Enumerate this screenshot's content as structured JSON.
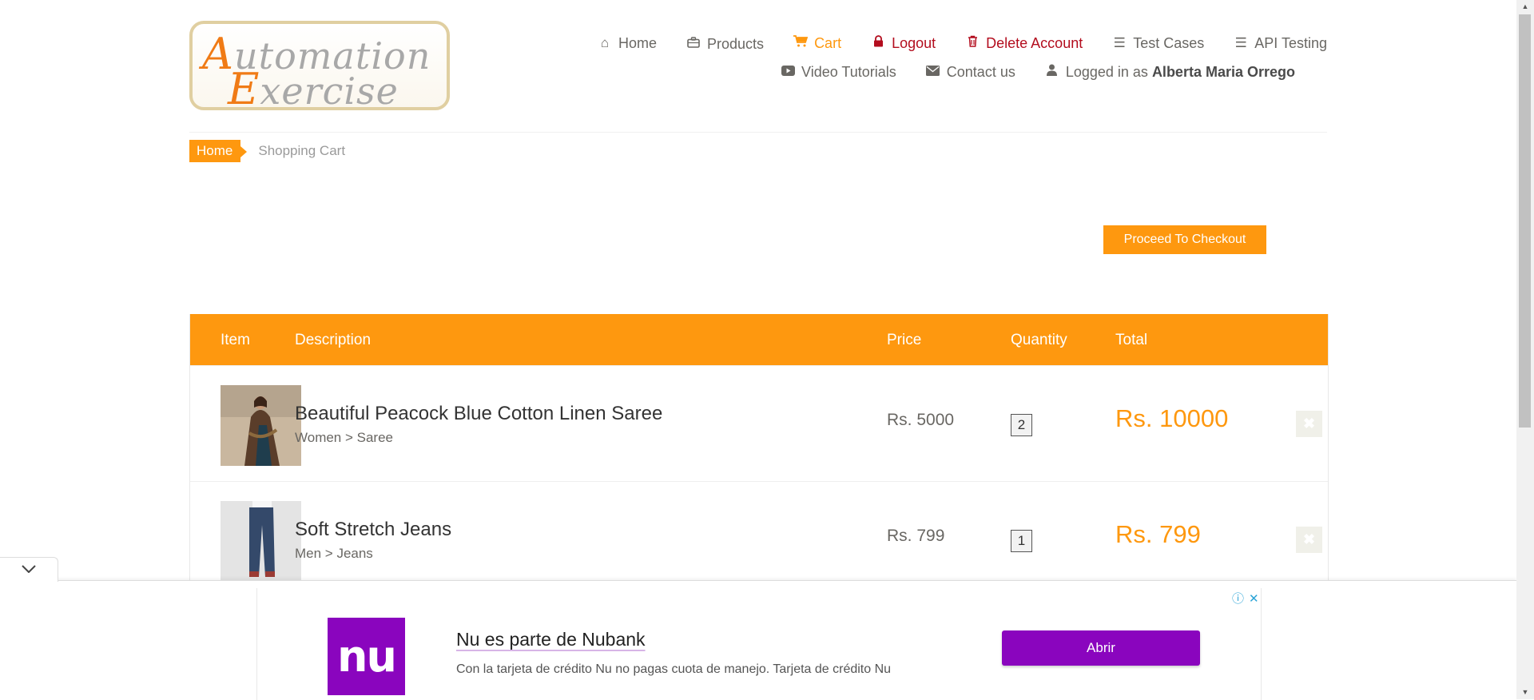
{
  "logo": {
    "line1_cap": "A",
    "line1_rest": "utomation",
    "line2_cap": "E",
    "line2_rest": "xercise"
  },
  "nav": {
    "home": "Home",
    "products": "Products",
    "cart": "Cart",
    "logout": "Logout",
    "delete_account": "Delete Account",
    "test_cases": "Test Cases",
    "api_testing": "API Testing",
    "video_tutorials": "Video Tutorials",
    "contact_us": "Contact us",
    "logged_in_prefix": "Logged in as",
    "logged_in_user": "Alberta Maria Orrego"
  },
  "breadcrumb": {
    "home": "Home",
    "current": "Shopping Cart"
  },
  "checkout_button": "Proceed To Checkout",
  "table": {
    "headers": {
      "item": "Item",
      "description": "Description",
      "price": "Price",
      "quantity": "Quantity",
      "total": "Total"
    },
    "rows": [
      {
        "name": "Beautiful Peacock Blue Cotton Linen Saree",
        "category": "Women > Saree",
        "price": "Rs. 5000",
        "quantity": "2",
        "total": "Rs. 10000"
      },
      {
        "name": "Soft Stretch Jeans",
        "category": "Men > Jeans",
        "price": "Rs. 799",
        "quantity": "1",
        "total": "Rs. 799"
      }
    ]
  },
  "ad": {
    "logo_text": "nu",
    "title": "Nu es parte de Nubank",
    "description": "Con la tarjeta de crédito Nu no pagas cuota de manejo. Tarjeta de crédito Nu",
    "button": "Abrir",
    "info_glyph": "ⓘ",
    "close_glyph": "✕"
  },
  "colors": {
    "accent": "#fe980f",
    "danger": "#b30d1e",
    "ad_brand": "#8a05be"
  }
}
